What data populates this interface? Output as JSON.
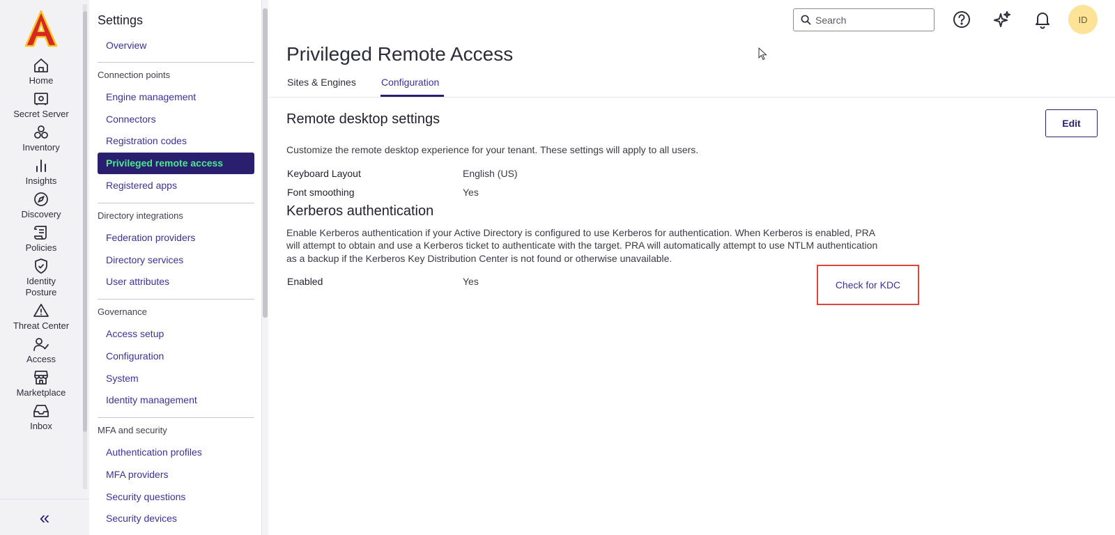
{
  "rail": {
    "items": [
      {
        "label": "Home",
        "icon": "home-icon"
      },
      {
        "label": "Secret Server",
        "icon": "vault-icon"
      },
      {
        "label": "Inventory",
        "icon": "inventory-icon"
      },
      {
        "label": "Insights",
        "icon": "bar-chart-icon"
      },
      {
        "label": "Discovery",
        "icon": "compass-icon"
      },
      {
        "label": "Policies",
        "icon": "scroll-icon"
      },
      {
        "label": "Identity Posture",
        "icon": "shield-check-icon"
      },
      {
        "label": "Threat Center",
        "icon": "warning-icon"
      },
      {
        "label": "Access",
        "icon": "user-check-icon"
      },
      {
        "label": "Marketplace",
        "icon": "store-icon"
      },
      {
        "label": "Inbox",
        "icon": "inbox-icon"
      }
    ],
    "collapse_glyph": "«"
  },
  "settings_nav": {
    "title": "Settings",
    "overview": "Overview",
    "groups": [
      {
        "heading": "Connection points",
        "items": [
          "Engine management",
          "Connectors",
          "Registration codes",
          "Privileged remote access",
          "Registered apps"
        ]
      },
      {
        "heading": "Directory integrations",
        "items": [
          "Federation providers",
          "Directory services",
          "User attributes"
        ]
      },
      {
        "heading": "Governance",
        "items": [
          "Access setup",
          "Configuration",
          "System",
          "Identity management"
        ]
      },
      {
        "heading": "MFA and security",
        "items": [
          "Authentication profiles",
          "MFA providers",
          "Security questions",
          "Security devices"
        ]
      }
    ],
    "active_item": "Privileged remote access"
  },
  "topbar": {
    "search_placeholder": "Search",
    "avatar_initials": "ID"
  },
  "main": {
    "title": "Privileged Remote Access",
    "tabs": [
      {
        "label": "Sites & Engines",
        "active": false
      },
      {
        "label": "Configuration",
        "active": true
      }
    ],
    "remote_desktop": {
      "title": "Remote desktop settings",
      "edit_label": "Edit",
      "description": "Customize the remote desktop experience for your tenant. These settings will apply to all users.",
      "properties": [
        {
          "label": "Keyboard Layout",
          "value": "English (US)"
        },
        {
          "label": "Font smoothing",
          "value": "Yes"
        }
      ]
    },
    "kerberos": {
      "title": "Kerberos authentication",
      "description_lines": [
        "Enable Kerberos authentication if your Active Directory is configured to use Kerberos for authentication. When Kerberos is enabled, PRA",
        "will attempt to obtain and use a Kerberos ticket to authenticate with the target. PRA will automatically attempt to use NTLM authentication",
        "as a backup if the Kerberos Key Distribution Center is not found or otherwise unavailable."
      ],
      "enabled_label": "Enabled",
      "enabled_value": "Yes",
      "check_kdc_label": "Check for KDC"
    }
  },
  "colors": {
    "accent": "#2a1f6f",
    "link": "#3a3296",
    "active_text": "#4dea8c",
    "highlight_border": "#e0443e",
    "avatar_bg": "#fce398"
  }
}
